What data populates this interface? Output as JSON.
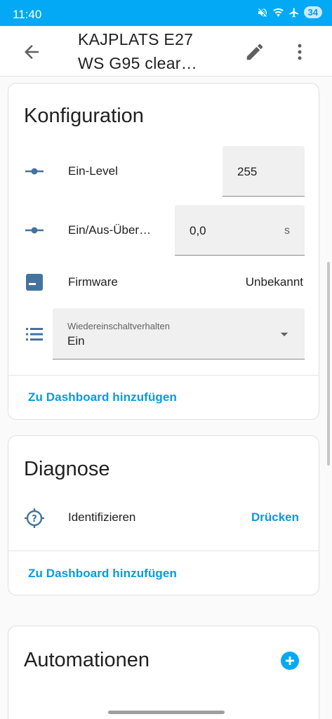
{
  "status_bar": {
    "time": "11:40",
    "battery": "34"
  },
  "app_bar": {
    "title_line1": "KAJPLATS E27",
    "title_line2": "WS G95 clear…"
  },
  "configuration": {
    "title": "Konfiguration",
    "on_level": {
      "label": "Ein-Level",
      "value": "255"
    },
    "transition": {
      "label": "Ein/Aus-Über…",
      "value": "0,0",
      "unit": "s"
    },
    "firmware": {
      "label": "Firmware",
      "value": "Unbekannt"
    },
    "power_on_behavior": {
      "label": "Wiedereinschaltverhalten",
      "selected": "Ein"
    },
    "add_to_dashboard": "Zu Dashboard hinzufügen"
  },
  "diagnostics": {
    "title": "Diagnose",
    "identify": {
      "label": "Identifizieren",
      "action": "Drücken"
    },
    "add_to_dashboard": "Zu Dashboard hinzufügen"
  },
  "automations": {
    "title": "Automationen"
  },
  "colors": {
    "accent": "#03a9f4",
    "link": "#039be5",
    "icon": "#44739e"
  }
}
